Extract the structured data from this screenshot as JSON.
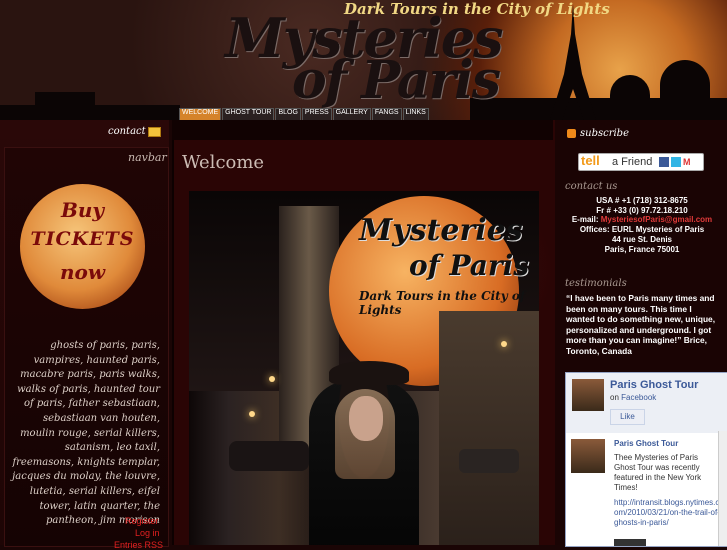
{
  "header": {
    "title_line1": "Mysteries",
    "title_line2": "of Paris",
    "tagline": "Dark Tours in the City of Lights"
  },
  "topnav": {
    "items": [
      "WELCOME",
      "GHOST TOUR",
      "BLOG",
      "PRESS",
      "GALLERY",
      "FANGS",
      "LINKS"
    ]
  },
  "left": {
    "contact_label": "contact",
    "navbar_title": "navbar",
    "tickets": [
      "Buy",
      "TICKETS",
      "now"
    ],
    "tags": "ghosts of paris, paris, vampires, haunted paris, macabre paris, paris walks, walks of paris, haunted tour of paris, father sebastiaan, sebastiaan van houten, moulin rouge, serial killers, satanism, leo taxil, freemasons, knights templar, jacques du molay, the louvre, lutetia, serial killers, eifel tower, latin quarter, the pantheon, jim morison",
    "register": "Register",
    "login": "Log in",
    "entries": "Entries RSS"
  },
  "main": {
    "title": "Welcome",
    "image_logo1": "Mysteries",
    "image_logo2": "of Paris",
    "image_logo3": "Dark Tours in the City of Lights"
  },
  "right": {
    "subscribe": "subscribe",
    "tell": "tell",
    "a_friend": "a Friend",
    "contact_heading": "contact us",
    "contact_lines": [
      "USA # +1 (718) 312-8675",
      "Fr # +33 (0) 97.72.18.210",
      "E-mail: MysteriesofParis@gmail.com",
      "Offices: EURL Mysteries of Paris",
      "44 rue St. Denis",
      "Paris, France 75001"
    ],
    "email_label": "E-mail: ",
    "email": "MysteriesofParis@gmail.com",
    "testimonials_heading": "testimonials",
    "testimonial": "“I have been to Paris many times and been on many tours. This time I wanted to do something new, unique, personalized and underground. I got more than you can imagine!” Brice, Toronto, Canada",
    "facebook": {
      "page_name": "Paris Ghost Tour",
      "on": "on",
      "facebook": "Facebook",
      "like": "Like",
      "post_name": "Paris Ghost Tour",
      "post_text": "Thee Mysteries of Paris Ghost Tour was recently featured in the New York Times!",
      "post_link": "http://intransit.blogs.nytimes.com/2010/03/21/on-the-trail-of-ghosts-in-paris/"
    }
  },
  "colors": {
    "accent": "#d5832a",
    "link_red": "#e02020",
    "fb_blue": "#3b5998"
  }
}
